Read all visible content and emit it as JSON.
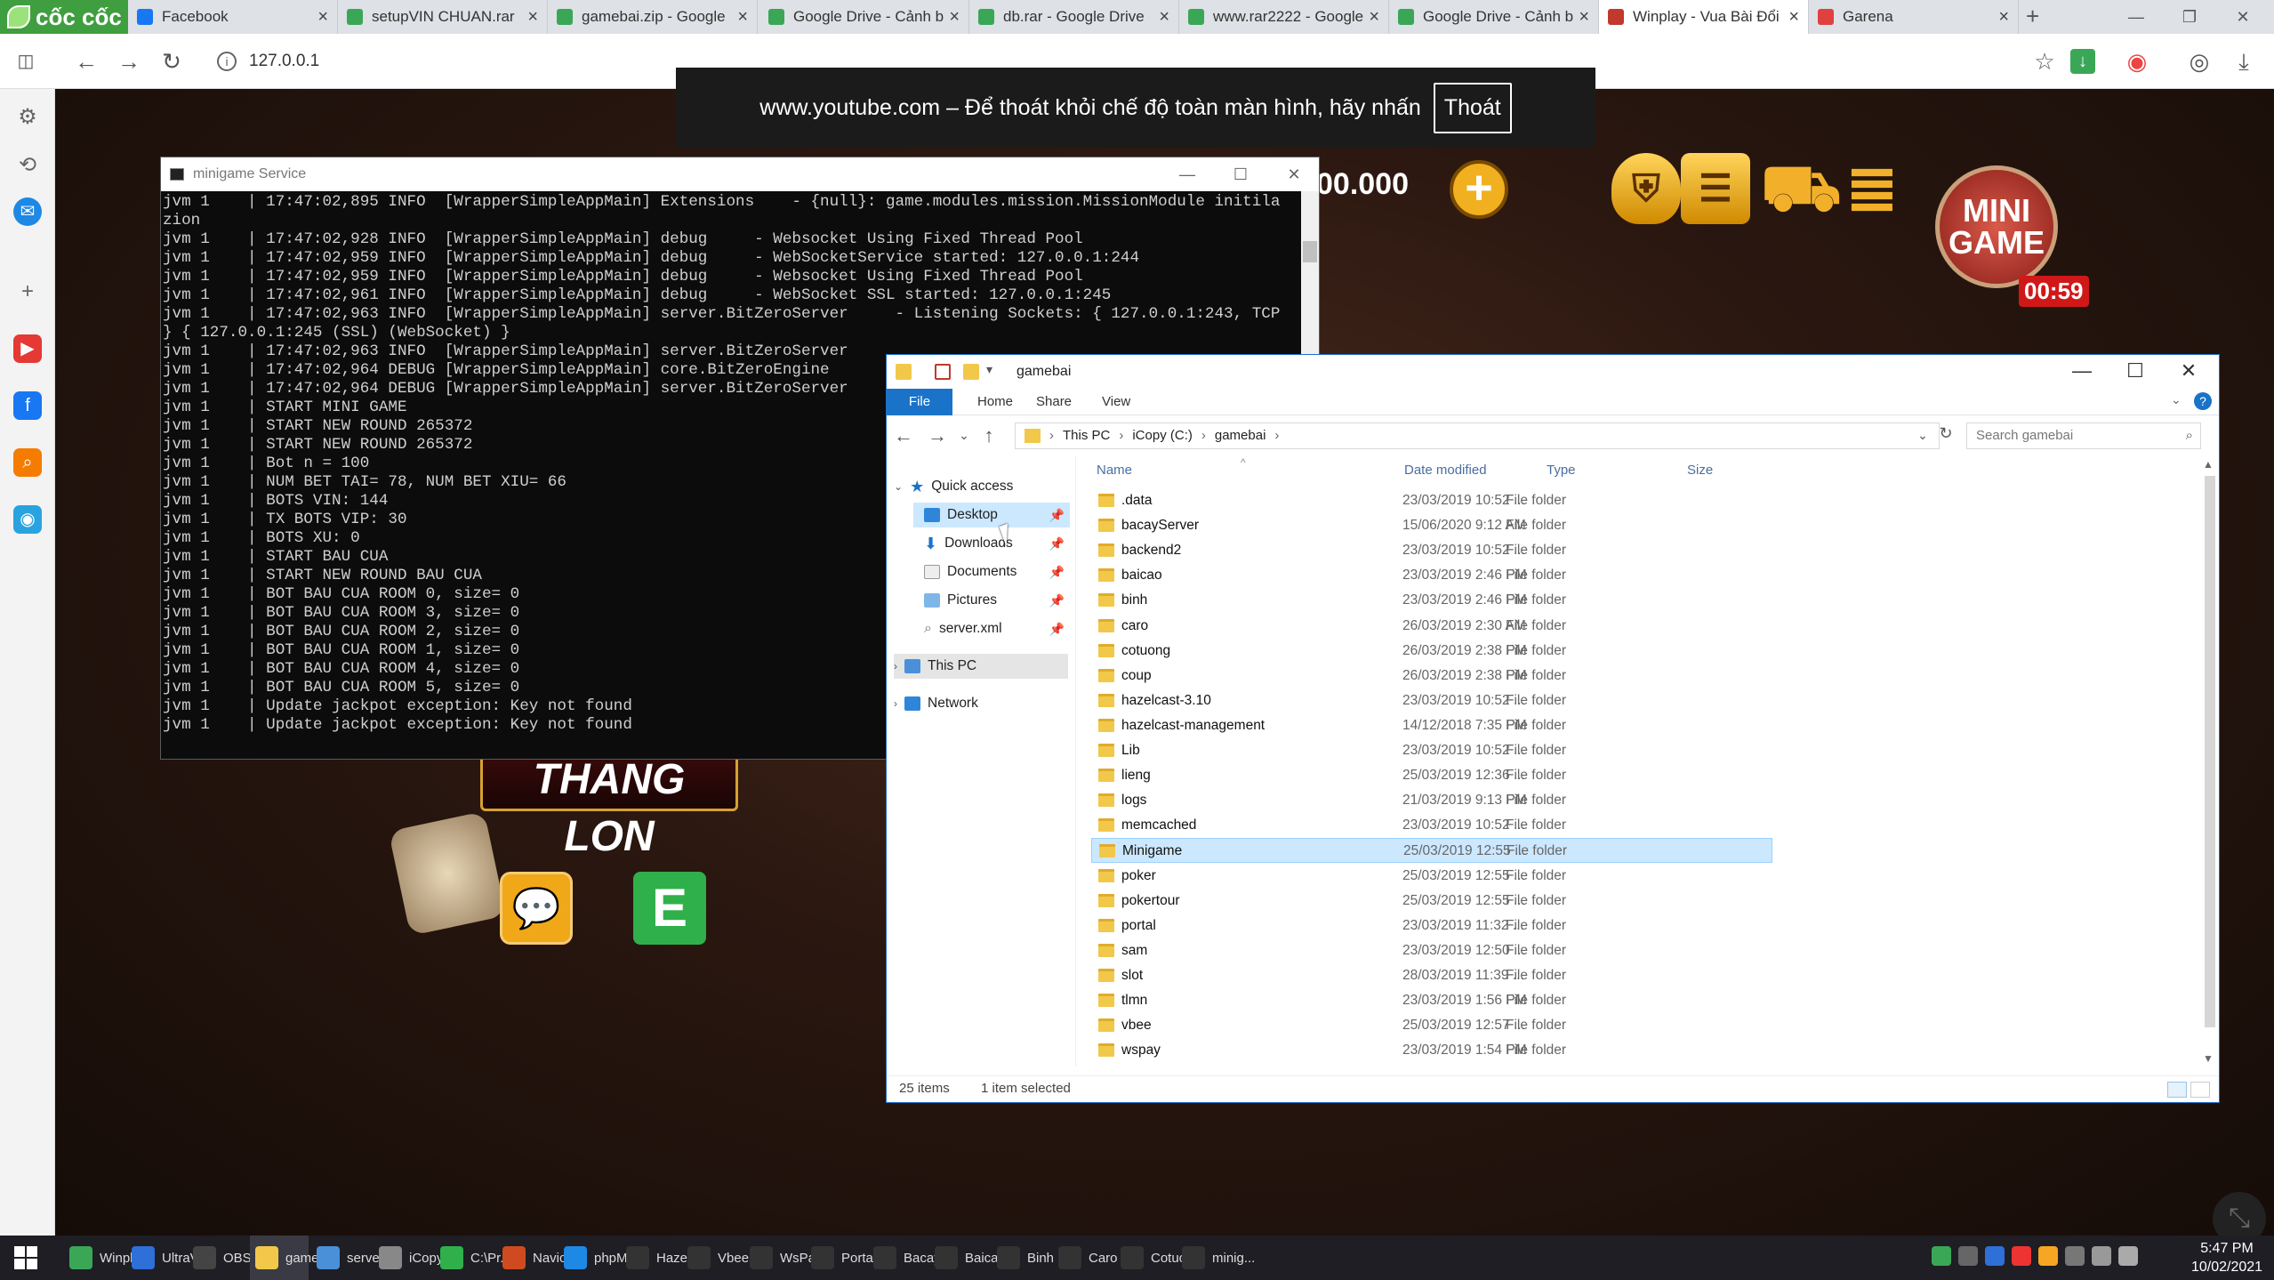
{
  "browser": {
    "brand": "cốc cốc",
    "tabs": [
      {
        "title": "Facebook",
        "color": "#1877f2",
        "close": "×"
      },
      {
        "title": "setupVIN CHUAN.rar",
        "color": "#3aa757",
        "close": "×"
      },
      {
        "title": "gamebai.zip - Google",
        "color": "#3aa757",
        "close": "×"
      },
      {
        "title": "Google Drive - Cảnh b",
        "color": "#3aa757",
        "close": "×"
      },
      {
        "title": "db.rar - Google Drive",
        "color": "#3aa757",
        "close": "×"
      },
      {
        "title": "www.rar2222 - Google",
        "color": "#3aa757",
        "close": "×"
      },
      {
        "title": "Google Drive - Cảnh b",
        "color": "#3aa757",
        "close": "×"
      },
      {
        "title": "Winplay - Vua Bài Đổi",
        "color": "#c0392b",
        "close": "×"
      },
      {
        "title": "Garena",
        "color": "#e04040",
        "close": "×"
      }
    ],
    "new_tab": "+",
    "url": "127.0.0.1",
    "info_icon": "i"
  },
  "youtube_banner": {
    "text": "www.youtube.com – Để thoát khỏi chế độ toàn màn hình, hãy nhấn",
    "exit_label": "Thoát"
  },
  "game": {
    "balance": "00.000",
    "plus": "+",
    "minigame_line1": "MINI",
    "minigame_line2": "GAME",
    "timer": "00:59",
    "banner": "THANG LON",
    "e_button": "E"
  },
  "console": {
    "title": "minigame Service",
    "lines": [
      "jvm 1    | 17:47:02,895 INFO  [WrapperSimpleAppMain] Extensions    - {null}: game.modules.mission.MissionModule initila",
      "zion",
      "jvm 1    | 17:47:02,928 INFO  [WrapperSimpleAppMain] debug     - Websocket Using Fixed Thread Pool",
      "jvm 1    | 17:47:02,959 INFO  [WrapperSimpleAppMain] debug     - WebSocketService started: 127.0.0.1:244",
      "jvm 1    | 17:47:02,959 INFO  [WrapperSimpleAppMain] debug     - Websocket Using Fixed Thread Pool",
      "jvm 1    | 17:47:02,961 INFO  [WrapperSimpleAppMain] debug     - WebSocket SSL started: 127.0.0.1:245",
      "jvm 1    | 17:47:02,963 INFO  [WrapperSimpleAppMain] server.BitZeroServer     - Listening Sockets: { 127.0.0.1:243, TCP",
      "} { 127.0.0.1:245 (SSL) (WebSocket) }",
      "jvm 1    | 17:47:02,963 INFO  [WrapperSimpleAppMain] server.BitZeroServer",
      "jvm 1    | 17:47:02,964 DEBUG [WrapperSimpleAppMain] core.BitZeroEngine",
      "jvm 1    | 17:47:02,964 DEBUG [WrapperSimpleAppMain] server.BitZeroServer",
      "jvm 1    | START MINI GAME",
      "jvm 1    | START NEW ROUND 265372",
      "jvm 1    | START NEW ROUND 265372",
      "jvm 1    | Bot n = 100",
      "jvm 1    | NUM BET TAI= 78, NUM BET XIU= 66",
      "jvm 1    | BOTS VIN: 144",
      "jvm 1    | TX BOTS VIP: 30",
      "jvm 1    | BOTS XU: 0",
      "jvm 1    | START BAU CUA",
      "jvm 1    | START NEW ROUND BAU CUA",
      "jvm 1    | BOT BAU CUA ROOM 0, size= 0",
      "jvm 1    | BOT BAU CUA ROOM 3, size= 0",
      "jvm 1    | BOT BAU CUA ROOM 2, size= 0",
      "jvm 1    | BOT BAU CUA ROOM 1, size= 0",
      "jvm 1    | BOT BAU CUA ROOM 4, size= 0",
      "jvm 1    | BOT BAU CUA ROOM 5, size= 0",
      "jvm 1    | Update jackpot exception: Key not found",
      "jvm 1    | Update jackpot exception: Key not found"
    ]
  },
  "explorer": {
    "title": "gamebai",
    "ribbon_tabs": [
      "File",
      "Home",
      "Share",
      "View"
    ],
    "breadcrumb": [
      "This PC",
      "iCopy (C:)",
      "gamebai"
    ],
    "search_placeholder": "Search gamebai",
    "nav": {
      "quick_access": "Quick access",
      "items": [
        "Desktop",
        "Downloads",
        "Documents",
        "Pictures",
        "server.xml"
      ],
      "this_pc": "This PC",
      "network": "Network"
    },
    "columns": [
      "Name",
      "Date modified",
      "Type",
      "Size"
    ],
    "files": [
      {
        "name": ".data",
        "date": "23/03/2019 10:52 ...",
        "type": "File folder"
      },
      {
        "name": "bacayServer",
        "date": "15/06/2020 9:12 AM",
        "type": "File folder"
      },
      {
        "name": "backend2",
        "date": "23/03/2019 10:52 ...",
        "type": "File folder"
      },
      {
        "name": "baicao",
        "date": "23/03/2019 2:46 PM",
        "type": "File folder"
      },
      {
        "name": "binh",
        "date": "23/03/2019 2:46 PM",
        "type": "File folder"
      },
      {
        "name": "caro",
        "date": "26/03/2019 2:30 AM",
        "type": "File folder"
      },
      {
        "name": "cotuong",
        "date": "26/03/2019 2:38 PM",
        "type": "File folder"
      },
      {
        "name": "coup",
        "date": "26/03/2019 2:38 PM",
        "type": "File folder"
      },
      {
        "name": "hazelcast-3.10",
        "date": "23/03/2019 10:52 ...",
        "type": "File folder"
      },
      {
        "name": "hazelcast-management",
        "date": "14/12/2018 7:35 PM",
        "type": "File folder"
      },
      {
        "name": "Lib",
        "date": "23/03/2019 10:52 ...",
        "type": "File folder"
      },
      {
        "name": "lieng",
        "date": "25/03/2019 12:36 ...",
        "type": "File folder"
      },
      {
        "name": "logs",
        "date": "21/03/2019 9:13 PM",
        "type": "File folder"
      },
      {
        "name": "memcached",
        "date": "23/03/2019 10:52 ...",
        "type": "File folder"
      },
      {
        "name": "Minigame",
        "date": "25/03/2019 12:55 ...",
        "type": "File folder"
      },
      {
        "name": "poker",
        "date": "25/03/2019 12:55 ...",
        "type": "File folder"
      },
      {
        "name": "pokertour",
        "date": "25/03/2019 12:55 ...",
        "type": "File folder"
      },
      {
        "name": "portal",
        "date": "23/03/2019 11:32 ...",
        "type": "File folder"
      },
      {
        "name": "sam",
        "date": "23/03/2019 12:50 ...",
        "type": "File folder"
      },
      {
        "name": "slot",
        "date": "28/03/2019 11:39 ...",
        "type": "File folder"
      },
      {
        "name": "tlmn",
        "date": "23/03/2019 1:56 PM",
        "type": "File folder"
      },
      {
        "name": "vbee",
        "date": "25/03/2019 12:57 ...",
        "type": "File folder"
      },
      {
        "name": "wspay",
        "date": "23/03/2019 1:54 PM",
        "type": "File folder"
      }
    ],
    "status_count": "25 items",
    "status_selected": "1 item selected"
  },
  "taskbar": {
    "items": [
      {
        "label": "Winpl...",
        "color": "#3aa757"
      },
      {
        "label": "UltraV...",
        "color": "#2e6fd8"
      },
      {
        "label": "OBS 2...",
        "color": "#444"
      },
      {
        "label": "game...",
        "color": "#f2c84b"
      },
      {
        "label": "server...",
        "color": "#4a90d9"
      },
      {
        "label": "iCopy ...",
        "color": "#888"
      },
      {
        "label": "C:\\Pr...",
        "color": "#2fb04a"
      },
      {
        "label": "Navic...",
        "color": "#d04a20"
      },
      {
        "label": "phpM...",
        "color": "#1e88e5"
      },
      {
        "label": "Hazel...",
        "color": "#333"
      },
      {
        "label": "Vbee ...",
        "color": "#333"
      },
      {
        "label": "WsPa...",
        "color": "#333"
      },
      {
        "label": "Portal...",
        "color": "#333"
      },
      {
        "label": "Bacay ...",
        "color": "#333"
      },
      {
        "label": "Baica...",
        "color": "#333"
      },
      {
        "label": "Binh ...",
        "color": "#333"
      },
      {
        "label": "Caro ...",
        "color": "#333"
      },
      {
        "label": "Cotuo...",
        "color": "#333"
      },
      {
        "label": "minig...",
        "color": "#333"
      }
    ],
    "time": "5:47 PM",
    "date": "10/02/2021"
  }
}
